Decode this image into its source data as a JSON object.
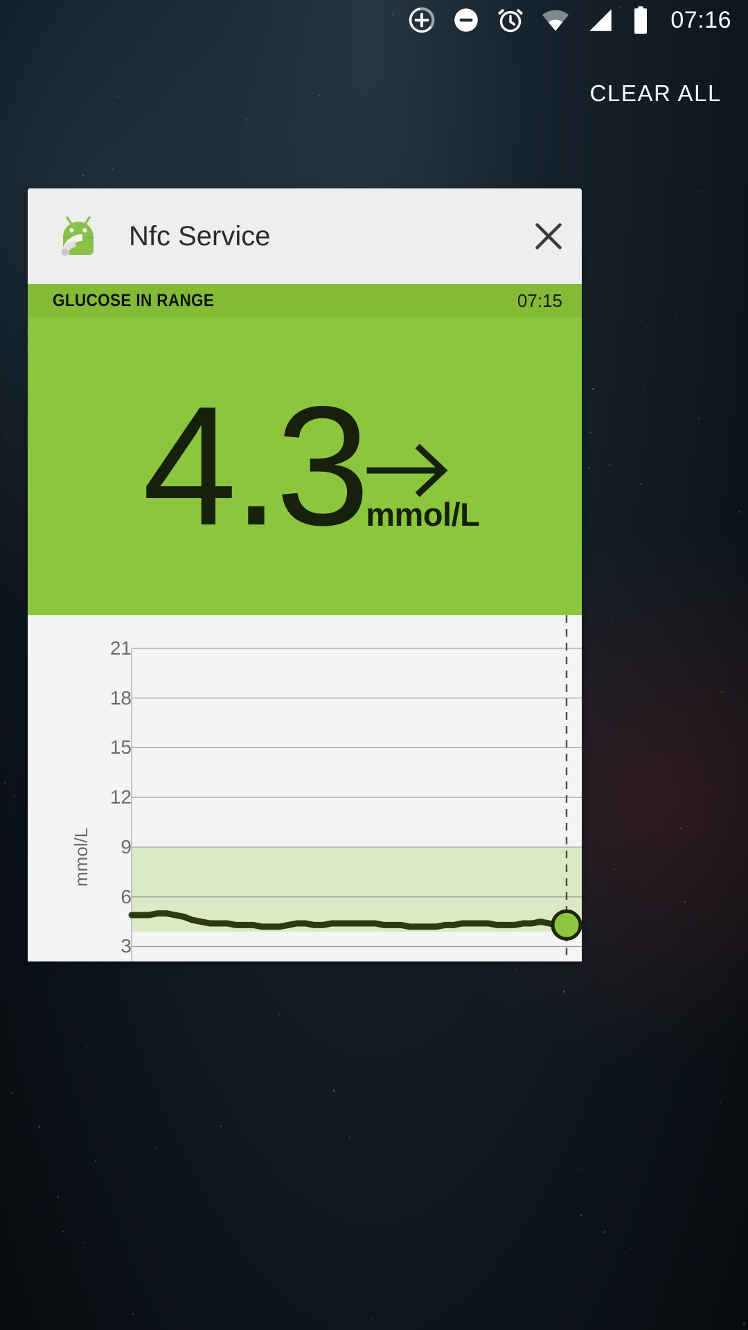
{
  "statusbar": {
    "time": "07:16",
    "icons": [
      {
        "name": "add-circle-icon",
        "glyph": "add"
      },
      {
        "name": "do-not-disturb-icon",
        "glyph": "dnd"
      },
      {
        "name": "alarm-icon",
        "glyph": "alarm"
      },
      {
        "name": "wifi-icon",
        "glyph": "wifi"
      },
      {
        "name": "cellular-signal-icon",
        "glyph": "signal"
      },
      {
        "name": "battery-icon",
        "glyph": "battery"
      }
    ]
  },
  "shade": {
    "clear_all_label": "CLEAR ALL"
  },
  "notification": {
    "app_name": "Nfc Service",
    "app_icon": "android-robot-nfc-icon",
    "close_icon": "close-icon",
    "status_label": "GLUCOSE IN RANGE",
    "status_time": "07:15",
    "reading_value": "4.3",
    "reading_unit": "mmol/L",
    "trend_icon": "arrow-right-icon",
    "colors": {
      "band": "#84bb36",
      "panel": "#8cc63e",
      "value_text": "#16200a",
      "chart_bg": "#f4f4f4",
      "target_band": "#dbe9c4",
      "trace": "#2e3b11",
      "marker_fill": "#8cc63e",
      "marker_stroke": "#1b2608",
      "card_bg": "#eeeeee"
    }
  },
  "chart_data": {
    "type": "line",
    "title": "",
    "xlabel": "",
    "ylabel": "mmol/L",
    "ylim": [
      2.1,
      22.0
    ],
    "yticks": [
      21,
      18,
      15,
      12,
      9,
      6,
      3
    ],
    "grid": true,
    "legend": null,
    "target_range": [
      3.9,
      9.0
    ],
    "current_marker": {
      "x": 100,
      "y": 4.3,
      "label": "4.3"
    },
    "now_line_x": 100,
    "series": [
      {
        "name": "glucose",
        "unit": "mmol/L",
        "x": [
          0,
          2,
          4,
          6,
          8,
          10,
          12,
          14,
          16,
          18,
          20,
          22,
          24,
          26,
          28,
          30,
          32,
          34,
          36,
          38,
          40,
          42,
          44,
          46,
          48,
          50,
          52,
          54,
          56,
          58,
          60,
          62,
          64,
          66,
          68,
          70,
          72,
          74,
          76,
          78,
          80,
          82,
          84,
          86,
          88,
          90,
          92,
          94,
          96,
          98,
          100
        ],
        "values": [
          4.9,
          4.9,
          4.9,
          5.0,
          5.0,
          4.9,
          4.8,
          4.6,
          4.5,
          4.4,
          4.4,
          4.4,
          4.3,
          4.3,
          4.3,
          4.2,
          4.2,
          4.2,
          4.3,
          4.4,
          4.4,
          4.3,
          4.3,
          4.4,
          4.4,
          4.4,
          4.4,
          4.4,
          4.4,
          4.3,
          4.3,
          4.3,
          4.2,
          4.2,
          4.2,
          4.2,
          4.3,
          4.3,
          4.4,
          4.4,
          4.4,
          4.4,
          4.3,
          4.3,
          4.3,
          4.4,
          4.4,
          4.5,
          4.4,
          4.3,
          4.3
        ]
      }
    ]
  }
}
